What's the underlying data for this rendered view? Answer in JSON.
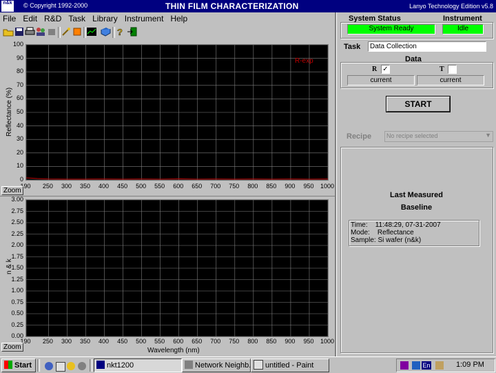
{
  "titlebar": {
    "logo": "n&k",
    "copyright": "© Copyright 1992-2000",
    "title": "THIN FILM CHARACTERIZATION",
    "edition": "Lanyo Technology Edition v5.8"
  },
  "menu": [
    "File",
    "Edit",
    "R&D",
    "Task",
    "Library",
    "Instrument",
    "Help"
  ],
  "toolbar": {
    "icons": [
      "open-folder-icon",
      "save-disk-icon",
      "print-icon",
      "people-icon",
      "wand-icon",
      "orange-box-icon",
      "chart-icon",
      "book-icon",
      "help-question-icon",
      "exit-door-icon"
    ]
  },
  "plots": {
    "top": {
      "ylabel": "Reflectance (%)",
      "yticks": [
        "100",
        "90",
        "80",
        "70",
        "60",
        "50",
        "40",
        "30",
        "20",
        "10",
        "0"
      ],
      "xticks": [
        "190",
        "250",
        "300",
        "350",
        "400",
        "450",
        "500",
        "550",
        "600",
        "650",
        "700",
        "750",
        "800",
        "850",
        "900",
        "950",
        "1000"
      ],
      "legend": "R-exp",
      "zoom": "Zoom"
    },
    "bottom": {
      "ylabel": "n & k",
      "yticks": [
        "3.00",
        "2.75",
        "2.50",
        "2.25",
        "2.00",
        "1.75",
        "1.50",
        "1.25",
        "1.00",
        "0.75",
        "0.50",
        "0.25",
        "0.00"
      ],
      "xticks": [
        "190",
        "250",
        "300",
        "350",
        "400",
        "450",
        "500",
        "550",
        "600",
        "650",
        "700",
        "750",
        "800",
        "850",
        "900",
        "950",
        "1000"
      ],
      "xlabel": "Wavelength (nm)",
      "zoom": "Zoom"
    }
  },
  "chart_data": [
    {
      "type": "line",
      "ylabel": "Reflectance (%)",
      "xlabel": "",
      "xlim": [
        190,
        1000
      ],
      "ylim": [
        0,
        100
      ],
      "series": [
        {
          "name": "R-exp",
          "color": "#c00000",
          "x": [
            190,
            200,
            220,
            250,
            300,
            350,
            400,
            450,
            500,
            550,
            600,
            650,
            700,
            750,
            800,
            850,
            900,
            950,
            1000
          ],
          "y": [
            1.5,
            1.4,
            1.0,
            0.7,
            0.6,
            0.6,
            0.7,
            0.6,
            0.7,
            0.6,
            0.8,
            0.6,
            0.7,
            0.6,
            0.7,
            0.6,
            0.7,
            0.6,
            0.7
          ]
        }
      ],
      "grid": true
    },
    {
      "type": "line",
      "ylabel": "n & k",
      "xlabel": "Wavelength (nm)",
      "xlim": [
        190,
        1000
      ],
      "ylim": [
        0,
        3
      ],
      "series": [],
      "grid": true
    }
  ],
  "status": {
    "system_status_label": "System Status",
    "system_status_value": "System Ready",
    "instrument_label": "Instrument",
    "instrument_value": "Idle",
    "status_color": "#00ff00"
  },
  "task": {
    "label": "Task",
    "value": "Data Collection"
  },
  "data_group": {
    "label": "Data",
    "r_label": "R",
    "r_checked": true,
    "r_value": "current",
    "t_label": "T",
    "t_checked": false,
    "t_value": "current"
  },
  "start_button": "START",
  "recipe": {
    "label": "Recipe",
    "value": "No recipe selected"
  },
  "last_measured": {
    "title1": "Last Measured",
    "title2": "Baseline",
    "time": "Time:    11:48:29, 07-31-2007",
    "mode": "Mode:    Reflectance",
    "sample": "Sample: Si wafer (n&k)"
  },
  "taskbar": {
    "start": "Start",
    "buttons": [
      "nkt1200",
      "Network Neighb...",
      "untitled - Paint"
    ],
    "lang": "En",
    "clock": "1:09 PM"
  }
}
